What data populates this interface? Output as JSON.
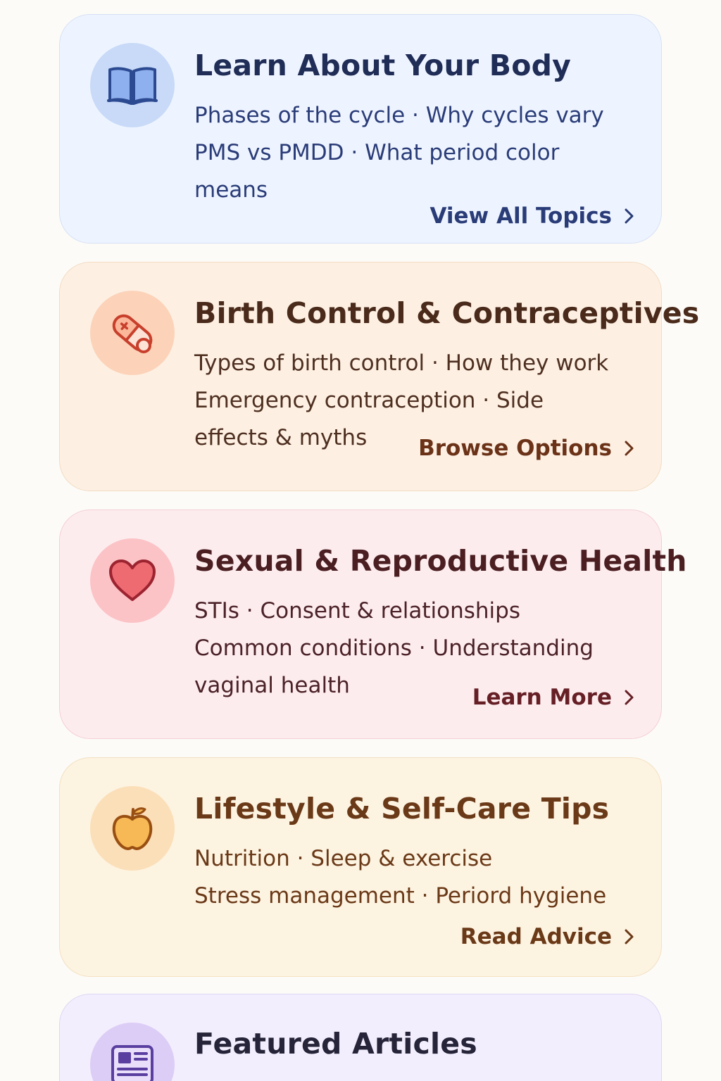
{
  "cards": [
    {
      "title": "Learn About Your Body",
      "icon": "open-book-icon",
      "topic_lines": [
        "Phases of the cycle · Why cycles vary",
        "PMS vs PMDD · What period color means"
      ],
      "cta": "View All Topics",
      "accent": "#2a3c78"
    },
    {
      "title": "Birth Control & Contraceptives",
      "icon": "pill-icon",
      "topic_lines": [
        "Types of birth control · How they work",
        "Emergency contraception · Side effects & myths"
      ],
      "cta": "Browse Options",
      "accent": "#6b3218"
    },
    {
      "title": "Sexual & Reproductive Health",
      "icon": "heart-icon",
      "topic_lines": [
        "STIs · Consent & relationships",
        "Common conditions · Understanding vaginal health"
      ],
      "cta": "Learn More",
      "accent": "#651f25"
    },
    {
      "title": "Lifestyle & Self-Care Tips",
      "icon": "apple-icon",
      "topic_lines": [
        "Nutrition · Sleep & exercise",
        "Stress management · Periord hygiene"
      ],
      "cta": "Read Advice",
      "accent": "#6a3917"
    },
    {
      "title": "Featured Articles",
      "icon": "article-icon",
      "accent": "#5a3fa0"
    }
  ]
}
